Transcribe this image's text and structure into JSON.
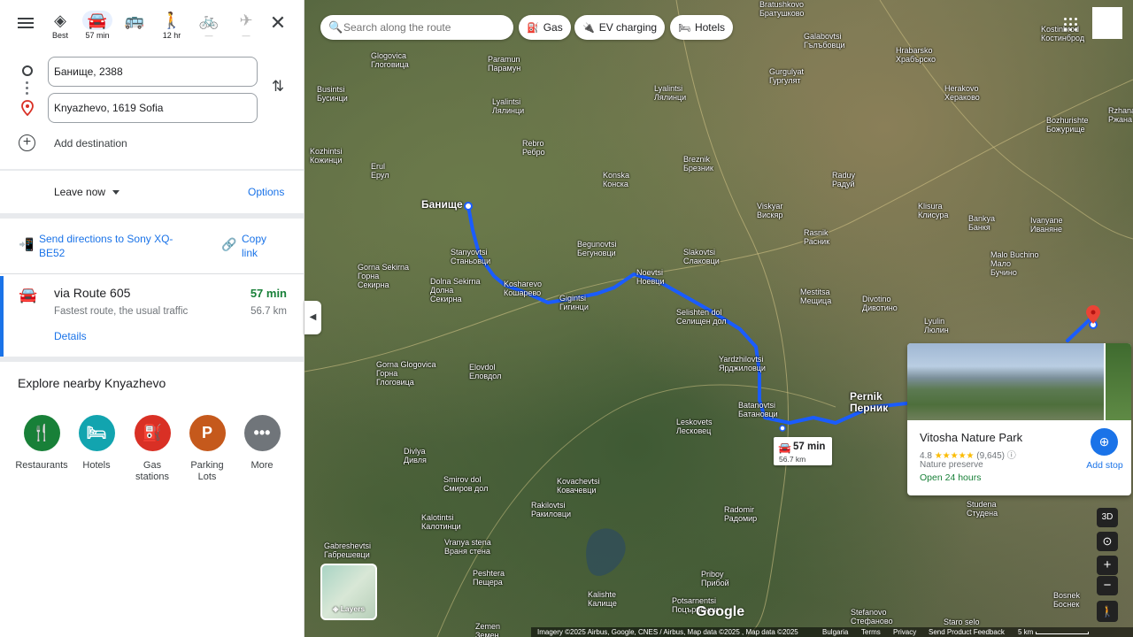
{
  "panel": {
    "travel_modes": [
      {
        "name": "best",
        "icon": "diamond-directions-icon",
        "label": "Best",
        "state": "normal"
      },
      {
        "name": "driving",
        "icon": "car-icon",
        "label": "57 min",
        "state": "selected"
      },
      {
        "name": "transit",
        "icon": "bus-icon",
        "label": "",
        "state": "normal"
      },
      {
        "name": "walking",
        "icon": "walking-icon",
        "label": "12 hr",
        "state": "normal"
      },
      {
        "name": "cycling",
        "icon": "bicycle-icon",
        "label": "—",
        "state": "disabled"
      },
      {
        "name": "flight",
        "icon": "airplane-icon",
        "label": "—",
        "state": "disabled"
      }
    ],
    "origin": {
      "value": "Банище, 2388"
    },
    "destination": {
      "value": "Knyazhevo, 1619 Sofia"
    },
    "add_destination_label": "Add destination",
    "leave_now_label": "Leave now",
    "options_label": "Options",
    "send_directions_label": "Send directions to Sony XQ-BE52",
    "copy_link_label": "Copy link",
    "route": {
      "via": "via Route 605",
      "description": "Fastest route, the usual traffic",
      "duration": "57 min",
      "distance": "56.7 km",
      "details_label": "Details"
    },
    "explore": {
      "title": "Explore nearby Knyazhevo",
      "categories": [
        {
          "label": "Restaurants",
          "icon": "fork-knife-icon",
          "color": "#188038"
        },
        {
          "label": "Hotels",
          "icon": "bed-icon",
          "color": "#12a4af"
        },
        {
          "label": "Gas stations",
          "icon": "gas-pump-icon",
          "color": "#d93025"
        },
        {
          "label": "Parking Lots",
          "icon": "parking-icon",
          "color": "#c5591c"
        },
        {
          "label": "More",
          "icon": "more-dots-icon",
          "color": "#70757a"
        }
      ]
    }
  },
  "map": {
    "search_placeholder": "Search along the route",
    "chips": [
      {
        "label": "Gas",
        "icon": "gas-pump-icon"
      },
      {
        "label": "EV charging",
        "icon": "ev-charging-icon"
      },
      {
        "label": "Hotels",
        "icon": "bed-icon"
      }
    ],
    "origin_label": "Банище",
    "route_callout": {
      "duration": "57 min",
      "distance": "56.7 km"
    },
    "places": [
      "Bratushkovo\nБратушково",
      "Galabovtsi\nГълъбовци",
      "Lyalintsi\nЛялинци",
      "Gurgulyat\nГургулят",
      "Glogovica\nГлоговица",
      "Paramun\nПарамун",
      "Busintsi\nБусинци",
      "Lyalintsi\nЛялинци",
      "Hrabarsko\nХрабърско",
      "Herakovo\nХераково",
      "Kozhintsi\nКожинци",
      "Rebro\nРебро",
      "Erul\nЕрул",
      "Breznik\nБрезник",
      "Konska\nКонска",
      "Raduy\nРадуй",
      "Viskyar\nВискяр",
      "Rasnik\nРасник",
      "Klisura\nКлисура",
      "Bankya\nБанкя",
      "Ivanyane\nИваняне",
      "Stanyovtsi\nСтаньовци",
      "Begunovtsi\nБегуновци",
      "Slakovtsi\nСлаковци",
      "Gorna Sekirna\nГорна\nСекирна",
      "Kosharevo\nКошарево",
      "Noevtsi\nНоевци",
      "Mestitsa\nМещица",
      "Divotino\nДивотино",
      "Malo Buchino\nМало\nБучино",
      "Dolna Sekirna\nДолна\nСекирна",
      "Gigintsi\nГигинци",
      "Selishten dol\nСелищен дол",
      "Lyulin\nЛюлин",
      "Yardzhilovtsi\nЯрджиловци",
      "Elovdol\nЕловдол",
      "Gorna Glogovica\nГорна\nГлоговица",
      "Batanovtsi\nБатановци",
      "Leskovets\nЛесковец",
      "Divlya\nДивля",
      "Smirov dol\nСмиров дол",
      "Kovachevtsi\nКовачевци",
      "Rakilovtsi\nРакиловци",
      "Kalotintsi\nКалотинци",
      "Vranya stena\nВраня стена",
      "Gabreshevtsi\nГабрешевци",
      "Peshtera\nПещера",
      "Radomir\nРадомир",
      "Priboy\nПрибой",
      "Kalishte\nКалище",
      "Potsarnentsi\nПоцърненци",
      "Stefanovo\nСтефаново",
      "Staro selo",
      "Zemen\nЗемен",
      "Studena\nСтудена",
      "Bosnek\nБоснек",
      "Bozhurishte\nБожурище",
      "Kostinbrod\nКостинброд",
      "Rzhana\nРжана",
      "Pernik\nПерник"
    ],
    "poi": {
      "name": "Vitosha Nature Park",
      "rating": "4.8",
      "stars": "★★★★★",
      "reviews": "(9,645)",
      "type": "Nature preserve",
      "hours": "Open 24 hours",
      "add_stop_label": "Add stop"
    },
    "controls": {
      "three_d": "3D",
      "zoom_in": "+",
      "zoom_out": "−"
    },
    "layers_label": "Layers",
    "google_logo": "Google",
    "footer": {
      "imagery": "Imagery ©2025 Airbus, Google, CNES / Airbus, Map data ©2025 , Map data ©2025",
      "country": "Bulgaria",
      "terms": "Terms",
      "privacy": "Privacy",
      "feedback": "Send Product Feedback",
      "scale": "5 km"
    },
    "route_color": "#1a5cff"
  }
}
